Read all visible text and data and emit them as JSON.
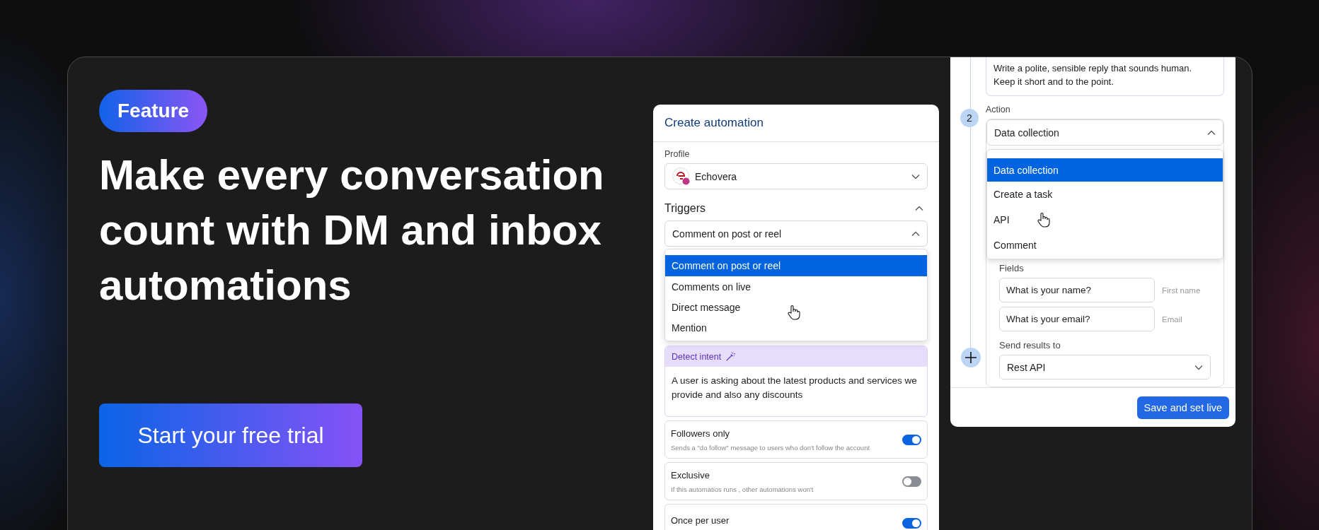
{
  "badge": "Feature",
  "headline": "Make every conversation count with DM and inbox automations",
  "cta": "Start your free trial",
  "automation_panel": {
    "title": "Create automation",
    "profile": {
      "label": "Profile",
      "value": "Echovera"
    },
    "triggers": {
      "label": "Triggers",
      "expanded": true,
      "value": "Comment on post or reel",
      "open": true,
      "options": [
        {
          "label": "Comment on post or reel",
          "selected": true
        },
        {
          "label": "Comments on live",
          "selected": false
        },
        {
          "label": "Direct message",
          "selected": false
        },
        {
          "label": "Mention",
          "selected": false
        }
      ]
    },
    "detect_intent": {
      "label": "Detect intent",
      "text": "A user is asking about the latest products and services we provide and also any discounts"
    },
    "settings": [
      {
        "title": "Followers only",
        "description": "Sends a \"do follow\" message to users who don't follow the account",
        "on": true
      },
      {
        "title": "Exclusive",
        "description": "If this automatios runs , other automations won't",
        "on": false
      },
      {
        "title": "Once per user",
        "on": true
      }
    ]
  },
  "action_panel": {
    "prompt": "Write a polite, sensible reply that sounds human.\nKeep it short and to the point.",
    "step": "2",
    "action": {
      "label": "Action",
      "value": "Data collection",
      "open": true,
      "options": [
        {
          "label": "Data collection",
          "selected": true
        },
        {
          "label": "Create a task",
          "selected": false
        },
        {
          "label": "API",
          "selected": false
        },
        {
          "label": "Comment",
          "selected": false
        }
      ]
    },
    "fields_label": "Fields",
    "fields": [
      {
        "question": "What is your name?",
        "name": "First name"
      },
      {
        "question": "What is your email?",
        "name": "Email"
      }
    ],
    "send_results": {
      "label": "Send results to",
      "value": "Rest API"
    },
    "save_button": "Save and set live"
  }
}
